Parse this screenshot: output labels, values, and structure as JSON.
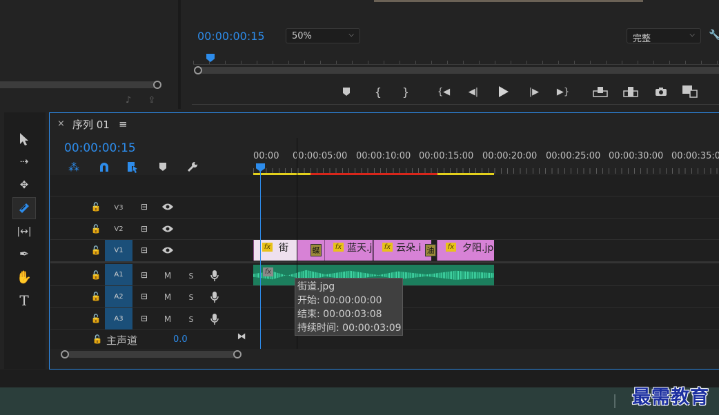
{
  "program": {
    "timecode": "00:00:00:15",
    "zoom": "50%",
    "quality": "完整"
  },
  "sequence": {
    "close": "×",
    "title": "序列 01",
    "menu": "≡",
    "timecode": "00:00:00:15",
    "ruler_labels": [
      "00:00",
      "00:00:05:00",
      "00:00:10:00",
      "00:00:15:00",
      "00:00:20:00",
      "00:00:25:00",
      "00:00:30:00",
      "00:00:35:00"
    ],
    "video_tracks": [
      {
        "name": "V3",
        "active": false
      },
      {
        "name": "V2",
        "active": false
      },
      {
        "name": "V1",
        "active": true
      }
    ],
    "audio_tracks": [
      {
        "name": "A1",
        "m": "M",
        "s": "S"
      },
      {
        "name": "A2",
        "m": "M",
        "s": "S"
      },
      {
        "name": "A3",
        "m": "M",
        "s": "S"
      }
    ],
    "master": {
      "label": "主声道",
      "value": "0.0"
    },
    "clips": [
      {
        "name": "街",
        "fx": "fx"
      },
      {
        "name": "蓝天.j",
        "fx": "fx"
      },
      {
        "name": "云朵.i",
        "fx": "fx"
      },
      {
        "name": "夕阳.jp",
        "fx": "fx"
      }
    ],
    "transition_labels": [
      "蝶",
      "油"
    ],
    "audio_fx": "fx"
  },
  "tooltip": {
    "name": "街道.jpg",
    "start": "开始: 00:00:00:00",
    "end": "结束: 00:00:03:08",
    "duration": "持续时间: 00:00:03:09"
  },
  "watermark": "最需教育",
  "colors": {
    "accent": "#2d8ceb",
    "clip": "#d782d6",
    "audio": "#1f9e73",
    "active_track": "#1b4f79"
  },
  "icons": [
    "selection-tool-icon",
    "track-select-icon",
    "ripple-edit-icon",
    "razor-icon",
    "slip-icon",
    "pen-icon",
    "hand-icon",
    "type-icon",
    "snap-icon",
    "linked-select-icon",
    "add-marker-icon",
    "wrench-icon",
    "lock-icon",
    "eye-icon",
    "mic-icon",
    "play-icon",
    "camera-icon"
  ]
}
